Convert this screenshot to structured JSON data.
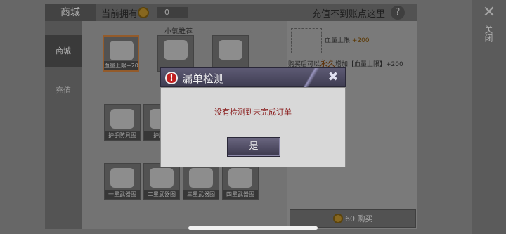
{
  "shop": {
    "header_title": "商城",
    "owned_label": "当前拥有",
    "owned_value": "0",
    "recharge_tip": "充值不到账点这里",
    "help_icon": "?",
    "nav": [
      {
        "label": "商城",
        "active": true
      },
      {
        "label": "充值",
        "active": false
      }
    ],
    "section_title": "小氪推荐",
    "items_row1": [
      {
        "caption": "血量上限+200",
        "icon": "heart-plus-icon"
      },
      {
        "caption": "",
        "icon": "backpack-icon"
      },
      {
        "caption": "",
        "icon": "stomach-icon"
      }
    ],
    "items_row2": [
      {
        "caption": "护手防具图",
        "icon": "blueprint-icon"
      },
      {
        "caption": "护腕防",
        "icon": "blueprint-icon"
      }
    ],
    "items_row3": [
      {
        "caption": "一星武器图",
        "icon": "weapon-blueprint-icon"
      },
      {
        "caption": "二星武器图",
        "icon": "weapon-blueprint-icon"
      },
      {
        "caption": "三星武器图",
        "icon": "weapon-blueprint-icon"
      },
      {
        "caption": "四星武器图",
        "icon": "weapon-blueprint-icon"
      }
    ],
    "detail": {
      "name": "血量上限",
      "name_value": "+200",
      "desc_prefix": "购买后可以",
      "desc_emphasis": "永久",
      "desc_suffix": "增加【血量上限】+200"
    },
    "buy_button": "60 购买",
    "close_label": "关闭"
  },
  "dialog": {
    "title": "漏单检测",
    "message": "没有检测到未完成订单",
    "confirm_label": "是",
    "warning_icon": "!",
    "close_icon": "✖"
  },
  "colors": {
    "dialog_header": "#4a475e",
    "dialog_body": "#d8d8d8",
    "message_text": "#8a1c1c",
    "warning_icon": "#c02020"
  }
}
